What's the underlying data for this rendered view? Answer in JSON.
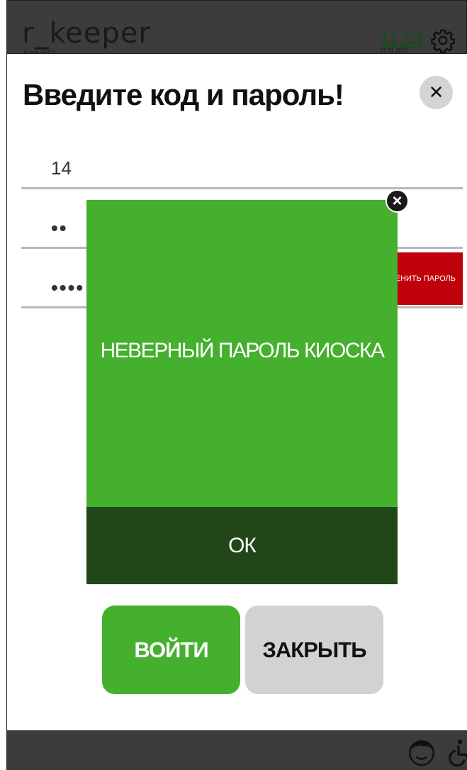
{
  "header": {
    "app_name": "r_keeper",
    "subtitle": "Kiosk PRO",
    "time": "11:53",
    "date": "01.01.2021",
    "settings_icon": "gear-icon"
  },
  "login_dialog": {
    "title": "Введите код и пароль!",
    "close_icon": "close-icon",
    "code_value": "14",
    "password_masked": "••",
    "kiosk_password_masked": "••••",
    "change_password_label": "ИЗМЕНИТЬ ПАРОЛЬ"
  },
  "error_modal": {
    "message": "НЕВЕРНЫЙ ПАРОЛЬ КИОСКА",
    "ok_label": "ОК",
    "close_icon": "close-icon",
    "background_color": "#44b02e",
    "ok_background_color": "#214617"
  },
  "actions": {
    "login_label": "ВОЙТИ",
    "close_label": "ЗАКРЫТЬ"
  },
  "footer": {
    "icons": [
      "child-face-icon",
      "wheelchair-icon"
    ]
  },
  "colors": {
    "accent_green": "#44b02e",
    "danger_red": "#c0000a",
    "header_bg": "#3c3c3c"
  }
}
